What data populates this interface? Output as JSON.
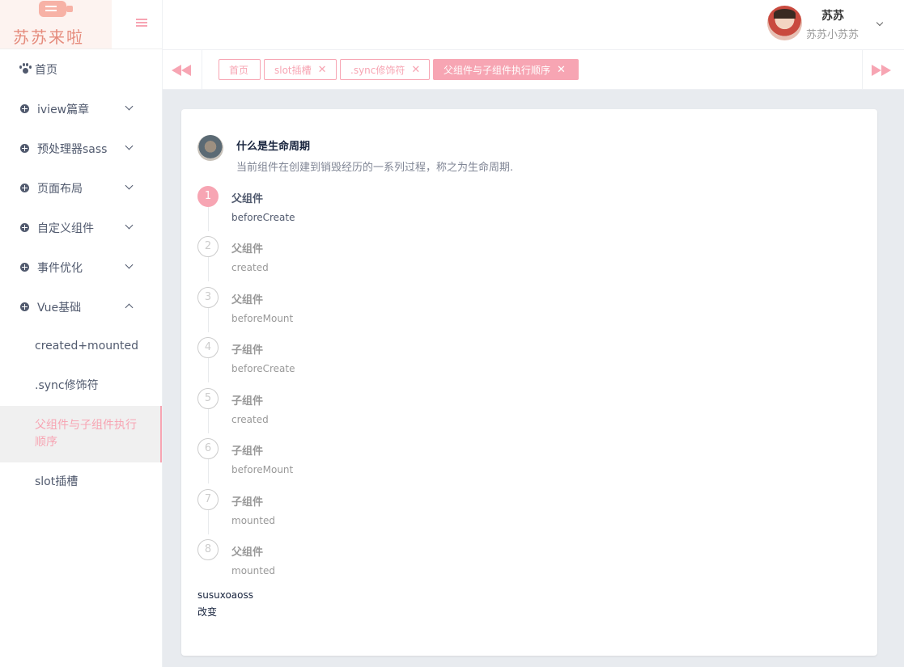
{
  "logo": {
    "text": "苏苏来啦"
  },
  "sidebar": {
    "items": [
      {
        "label": "首页"
      },
      {
        "label": "iview篇章"
      },
      {
        "label": "预处理器sass"
      },
      {
        "label": "页面布局"
      },
      {
        "label": "自定义组件"
      },
      {
        "label": "事件优化"
      },
      {
        "label": "Vue基础"
      }
    ],
    "subitems": [
      {
        "label": "created+mounted"
      },
      {
        "label": ".sync修饰符"
      },
      {
        "label": "父组件与子组件执行顺序",
        "active": true
      },
      {
        "label": "slot插槽"
      }
    ]
  },
  "header": {
    "user_name": "苏苏",
    "user_sub": "苏苏小苏苏"
  },
  "tabs": [
    {
      "label": "首页"
    },
    {
      "label": "slot插槽",
      "close": "✕"
    },
    {
      "label": ".sync修饰符",
      "close": "✕"
    },
    {
      "label": "父组件与子组件执行顺序",
      "close": "✕",
      "active": true
    }
  ],
  "content": {
    "title": "什么是生命周期",
    "description": "当前组件在创建到销毁经历的一系列过程，称之为生命周期.",
    "steps": [
      {
        "num": "1",
        "title": "父组件",
        "sub": "beforeCreate",
        "active": true
      },
      {
        "num": "2",
        "title": "父组件",
        "sub": "created"
      },
      {
        "num": "3",
        "title": "父组件",
        "sub": "beforeMount"
      },
      {
        "num": "4",
        "title": "子组件",
        "sub": "beforeCreate"
      },
      {
        "num": "5",
        "title": "子组件",
        "sub": "created"
      },
      {
        "num": "6",
        "title": "子组件",
        "sub": "beforeMount"
      },
      {
        "num": "7",
        "title": "子组件",
        "sub": "mounted"
      },
      {
        "num": "8",
        "title": "父组件",
        "sub": "mounted"
      }
    ],
    "footer_text": "susuxoaoss",
    "change_label": "改变"
  },
  "colors": {
    "accent": "#f7a5b3",
    "content_bg": "#e8ebef"
  }
}
